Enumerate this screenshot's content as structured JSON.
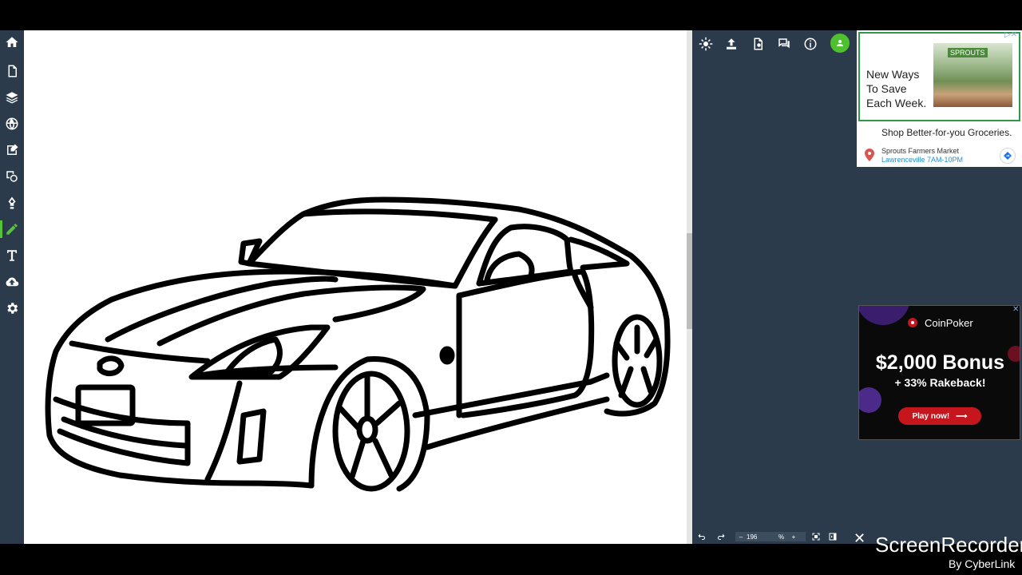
{
  "toolbar": {
    "tools": [
      "home-icon",
      "new-page-icon",
      "layers-icon",
      "globe-icon",
      "image-edit-icon",
      "shapes-icon",
      "ink-pen-icon",
      "pencil-icon",
      "text-icon",
      "upload-cloud-icon",
      "settings-icon"
    ]
  },
  "right_panel": {
    "icons": [
      "brightness-icon",
      "upload-icon",
      "new-file-icon",
      "chat-icon",
      "info-icon"
    ],
    "avatar_color": "#4fc12f",
    "zoom_value": "196",
    "zoom_unit": "%",
    "zoom_minus": "–",
    "zoom_plus": "+"
  },
  "ad_sprouts": {
    "headline_1": "New Ways",
    "headline_2": "To Save",
    "headline_3": "Each Week.",
    "sign": "SPROUTS",
    "tagline": "Shop Better-for-you Groceries.",
    "store": "Sprouts Farmers Market",
    "hours": "Lawrenceville 7AM-10PM"
  },
  "ad_coinpoker": {
    "brand": "CoinPoker",
    "bonus": "$2,000 Bonus",
    "rakeback": "+ 33% Rakeback!",
    "cta": "Play now!"
  },
  "watermark": {
    "title": "ScreenRecorder",
    "subtitle": "By CyberLink",
    "close": "✕"
  },
  "colors": {
    "panel_bg": "#2b3b4c",
    "accent_green": "#56c43a",
    "ad_cta_red": "#c4161c"
  }
}
